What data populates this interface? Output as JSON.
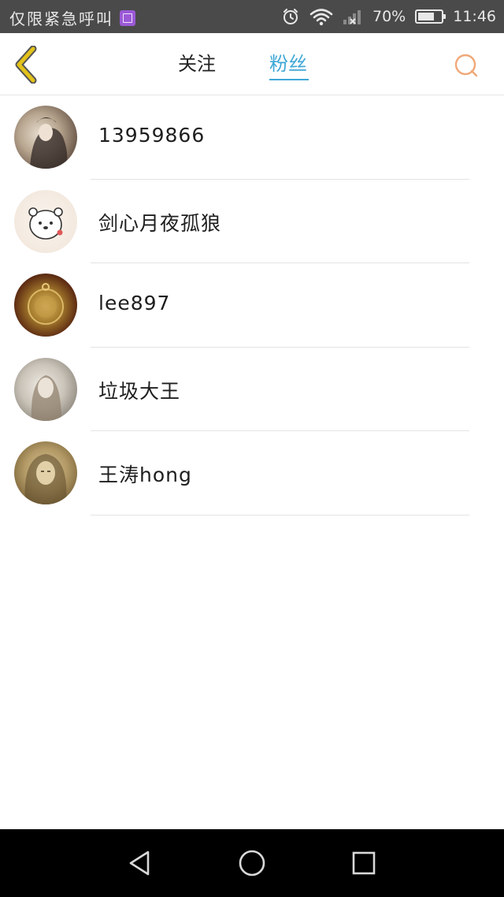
{
  "status_bar": {
    "carrier_text": "仅限紧急呼叫",
    "notification_icon": "gallery-icon",
    "battery_percent_text": "70%",
    "battery_level": 0.7,
    "time": "11:46",
    "icons": [
      "alarm-icon",
      "wifi-icon",
      "signal-icon",
      "battery-icon"
    ]
  },
  "header": {
    "back_icon": "chevron-left-icon",
    "tabs": [
      {
        "label": "关注",
        "active": false
      },
      {
        "label": "粉丝",
        "active": true
      }
    ],
    "search_icon": "search-icon",
    "colors": {
      "active_tab": "#3fa7d6",
      "back_icon": "#e3c21a",
      "search_icon": "#f0a878"
    }
  },
  "fans": [
    {
      "name": "13959866",
      "avatar": "avatar-image"
    },
    {
      "name": "剑心月夜孤狼",
      "avatar": "avatar-image"
    },
    {
      "name": "lee897",
      "avatar": "avatar-image"
    },
    {
      "name": "垃圾大王",
      "avatar": "avatar-image"
    },
    {
      "name": "王涛hong",
      "avatar": "avatar-image"
    }
  ],
  "nav_bar": {
    "buttons": [
      "back-triangle-icon",
      "home-circle-icon",
      "recent-square-icon"
    ]
  }
}
